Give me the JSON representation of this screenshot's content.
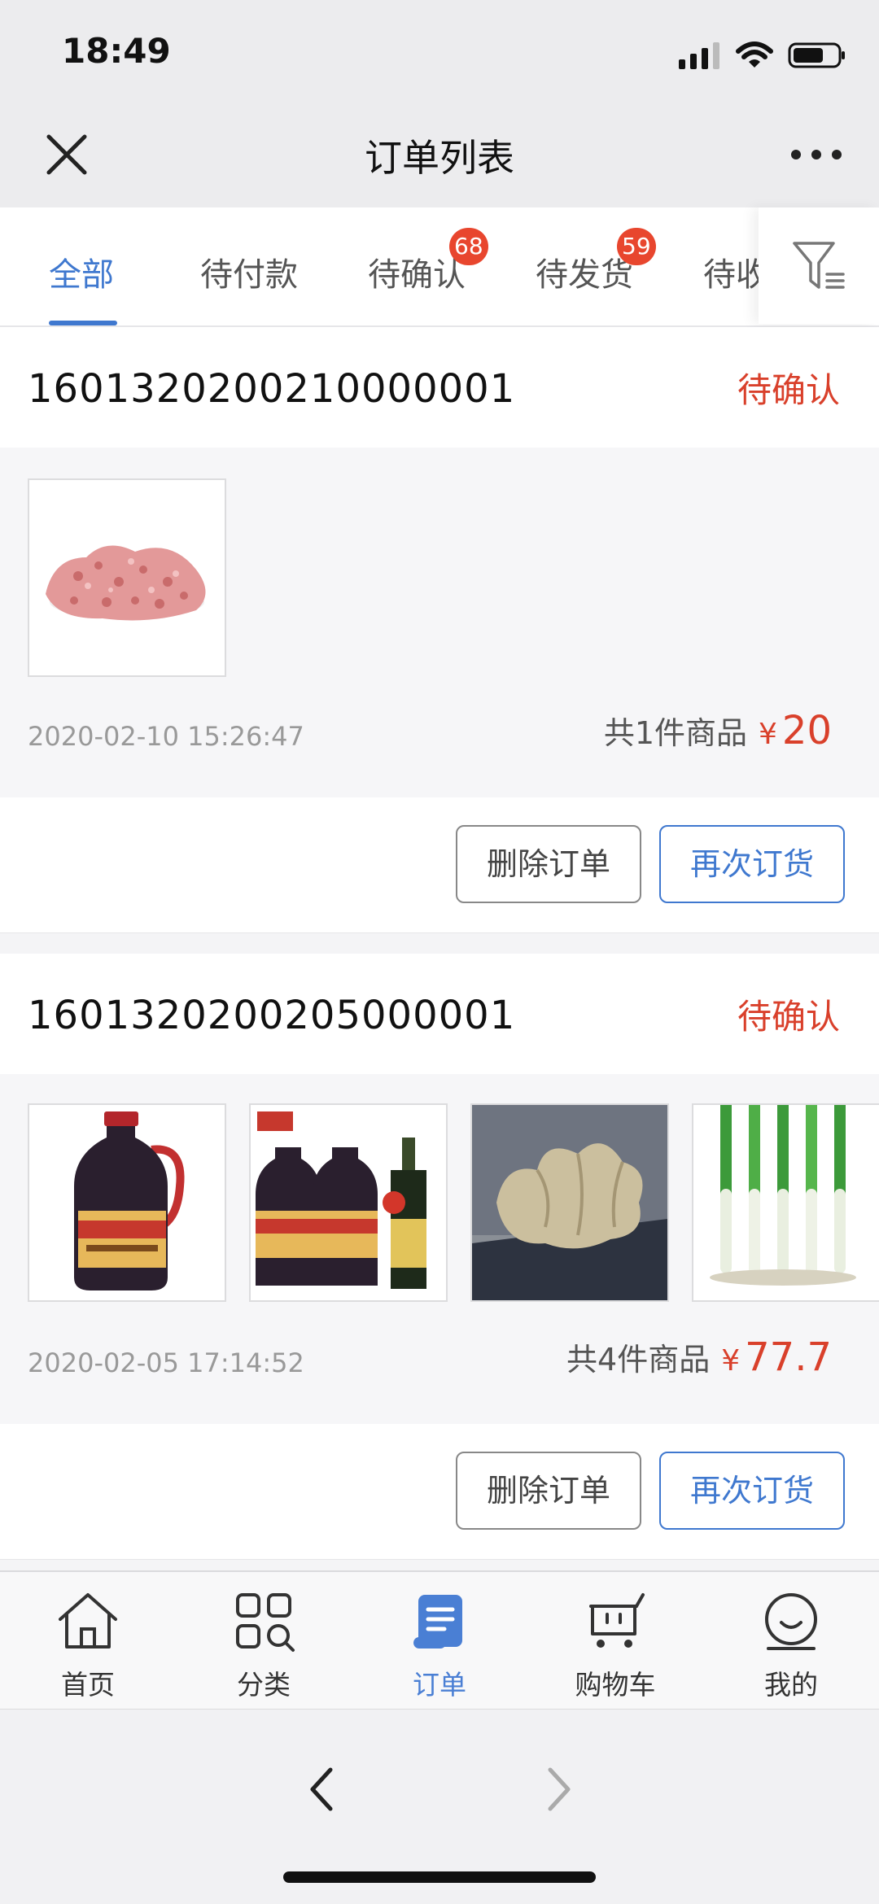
{
  "status_bar": {
    "time": "18:49"
  },
  "nav": {
    "title": "订单列表"
  },
  "tabs": [
    {
      "label": "全部",
      "active": true,
      "badge": ""
    },
    {
      "label": "待付款",
      "active": false,
      "badge": ""
    },
    {
      "label": "待确认",
      "active": false,
      "badge": "68"
    },
    {
      "label": "待发货",
      "active": false,
      "badge": "59"
    },
    {
      "label": "待收",
      "active": false,
      "badge": ""
    }
  ],
  "orders": [
    {
      "order_no": "1601320200210000001",
      "status": "待确认",
      "products": [
        "ground-pork"
      ],
      "date": "2020-02-10 15:26:47",
      "count_text": "共1件商品",
      "currency": "¥",
      "price": "20",
      "delete_label": "删除订单",
      "reorder_label": "再次订货"
    },
    {
      "order_no": "1601320200205000001",
      "status": "待确认",
      "products": [
        "soy-sauce-bottle",
        "soy-sauce-set",
        "ginger",
        "scallion"
      ],
      "date": "2020-02-05 17:14:52",
      "count_text": "共4件商品",
      "currency": "¥",
      "price": "77.7",
      "delete_label": "删除订单",
      "reorder_label": "再次订货"
    }
  ],
  "tabbar": {
    "items": [
      {
        "label": "首页",
        "icon": "home-icon",
        "active": false
      },
      {
        "label": "分类",
        "icon": "category-icon",
        "active": false
      },
      {
        "label": "订单",
        "icon": "order-icon",
        "active": true
      },
      {
        "label": "购物车",
        "icon": "cart-icon",
        "active": false
      },
      {
        "label": "我的",
        "icon": "profile-icon",
        "active": false
      }
    ]
  },
  "colors": {
    "accent": "#3f78cf",
    "alert": "#d9402b",
    "badge": "#e8462e"
  }
}
